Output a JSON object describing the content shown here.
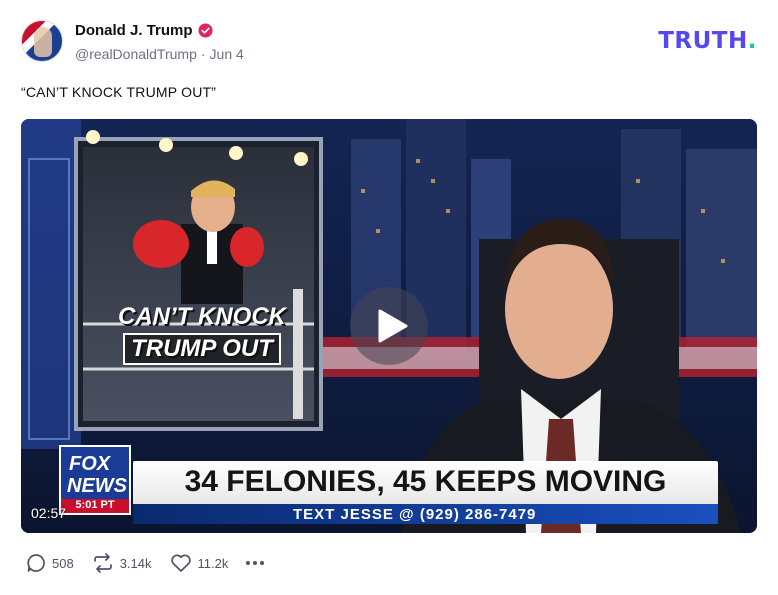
{
  "post": {
    "author_name": "Donald J. Trump",
    "handle": "@realDonaldTrump",
    "separator": "·",
    "date": "Jun 4",
    "text": "“CAN’T KNOCK TRUMP OUT”"
  },
  "brand": {
    "logo_text": "TRUTH",
    "logo_dot": ".",
    "primary_color": "#5448ee",
    "accent_color": "#17c7a6"
  },
  "video": {
    "duration": "02:57",
    "graphic_line1": "CAN’T KNOCK",
    "graphic_line2": "TRUMP OUT",
    "chyron": "34 FELONIES, 45 KEEPS MOVING",
    "chyron_sub": "TEXT JESSE @ (929) 286-7479",
    "network_line1": "FOX",
    "network_line2": "NEWS",
    "network_time": "5:01 PT",
    "icon": "play-icon"
  },
  "actions": {
    "replies": "508",
    "retruths": "3.14k",
    "likes": "11.2k",
    "icons": [
      "comment-icon",
      "retruth-icon",
      "heart-icon",
      "more-icon"
    ]
  }
}
